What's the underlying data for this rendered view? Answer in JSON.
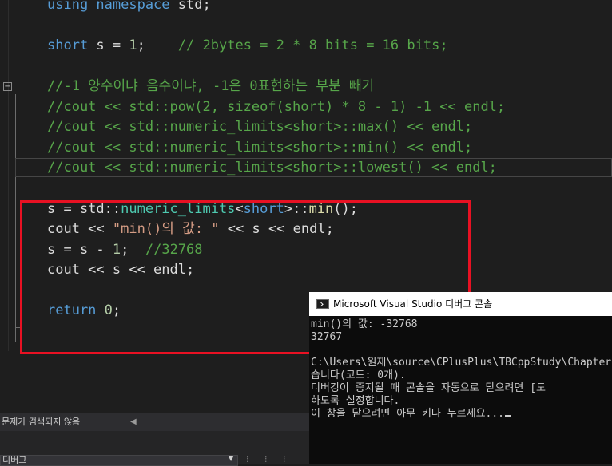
{
  "code": {
    "line1": {
      "kw": "using namespace",
      "rest": " std;"
    },
    "line2": {
      "type": "short",
      "mid": " s = ",
      "num": "1",
      "semi": ";",
      "comment": "    // 2bytes = 2 * 8 bits = 16 bits;"
    },
    "line3": {
      "comment": "//-1 양수이냐 음수이냐, -1은 0표현하는 부분 빼기"
    },
    "line4": {
      "comment": "//cout << std::pow(2, sizeof(short) * 8 - 1) -1 << endl;"
    },
    "line5": {
      "comment": "//cout << std::numeric_limits<short>::max() << endl;"
    },
    "line6": {
      "comment": "//cout << std::numeric_limits<short>::min() << endl;"
    },
    "line7": {
      "comment": "//cout << std::numeric_limits<short>::lowest() << endl;"
    },
    "line8": {
      "a": "s = std::",
      "b": "numeric_limits",
      "c": "<",
      "d": "short",
      "e": ">::",
      "f": "min",
      "g": "();"
    },
    "line9": {
      "a": "cout << ",
      "str": "\"min()의 값: \"",
      "b": " << s << endl;"
    },
    "line10": {
      "a": "s = s - ",
      "num": "1",
      "b": ";  ",
      "comment": "//32768"
    },
    "line11": {
      "a": "cout << s << endl;"
    },
    "line12": {
      "kw": "return",
      "sp": " ",
      "num": "0",
      "semi": ";"
    }
  },
  "console": {
    "title": "Microsoft Visual Studio 디버그 콘솔",
    "lines": [
      "min()의 값: -32768",
      "32767",
      "",
      "C:\\Users\\원재\\source\\CPlusPlus\\TBCppStudy\\Chapter",
      "습니다(코드: 0개).",
      "디버깅이 중지될 때 콘솔을 자동으로 닫으려면 [도",
      "하도록 설정합니다.",
      "이 창을 닫으려면 아무 키나 누르세요..."
    ]
  },
  "status": {
    "no_issues": "문제가 검색되지 않음",
    "nav_arrow": "◀"
  },
  "output": {
    "source_select": "디버그",
    "dropdown_icon": "▼",
    "tools": "⁞ ⁞ ⁞"
  }
}
